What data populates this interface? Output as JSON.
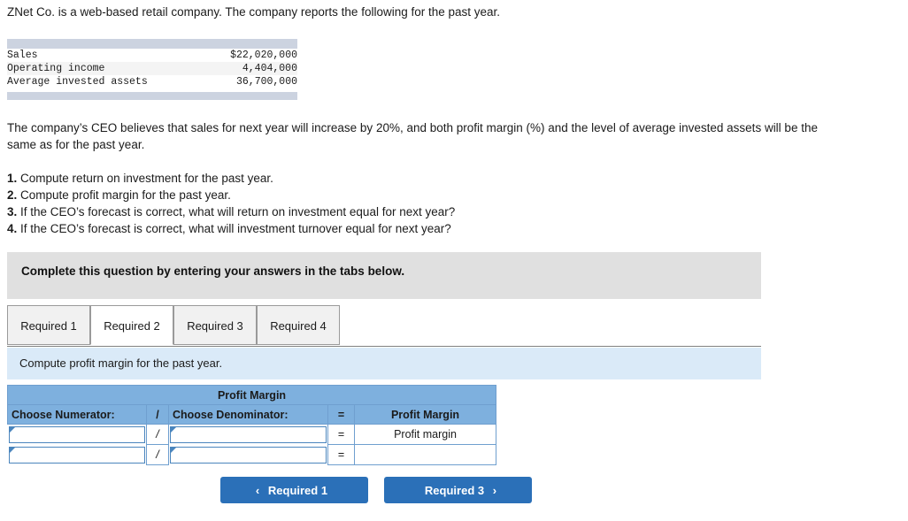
{
  "intro": {
    "text": "ZNet Co. is a web-based retail company. The company reports the following for the past year."
  },
  "facts_table": {
    "rows": [
      {
        "label": "Sales",
        "value": "$22,020,000"
      },
      {
        "label": "Operating income",
        "value": "4,404,000"
      },
      {
        "label": "Average invested assets",
        "value": "36,700,000"
      }
    ]
  },
  "ceo_paragraph": {
    "text": "The company’s CEO believes that sales for next year will increase by 20%, and both profit margin (%) and the level of average invested assets will be the same as for the past year."
  },
  "requirements": [
    {
      "num": "1.",
      "text": "Compute return on investment for the past year."
    },
    {
      "num": "2.",
      "text": "Compute profit margin for the past year."
    },
    {
      "num": "3.",
      "text": "If the CEO’s forecast is correct, what will return on investment equal for next year?"
    },
    {
      "num": "4.",
      "text": "If the CEO’s forecast is correct, what will investment turnover equal for next year?"
    }
  ],
  "banner": {
    "text": "Complete this question by entering your answers in the tabs below."
  },
  "tabs": {
    "items": [
      {
        "label": "Required 1",
        "active": false
      },
      {
        "label": "Required 2",
        "active": true
      },
      {
        "label": "Required 3",
        "active": false
      },
      {
        "label": "Required 4",
        "active": false
      }
    ]
  },
  "instruction_strip": {
    "text": "Compute profit margin for the past year."
  },
  "profit_margin_table": {
    "title": "Profit Margin",
    "headers": {
      "numerator": "Choose Numerator:",
      "slash": "/",
      "denominator": "Choose Denominator:",
      "equals": "=",
      "result": "Profit Margin"
    },
    "rows": [
      {
        "numerator_value": "",
        "slash": "/",
        "denominator_value": "",
        "equals": "=",
        "result": "Profit margin"
      },
      {
        "numerator_value": "",
        "slash": "/",
        "denominator_value": "",
        "equals": "=",
        "result": ""
      }
    ]
  },
  "nav": {
    "prev_chevron": "‹",
    "prev_label": "Required 1",
    "next_label": "Required 3",
    "next_chevron": "›"
  },
  "colors": {
    "accent_blue": "#2b70b8",
    "table_header_blue": "#7eb0de",
    "strip_blue": "#daeaf8",
    "banner_grey": "#e0e0e0",
    "facts_band": "#ccd3e0"
  }
}
